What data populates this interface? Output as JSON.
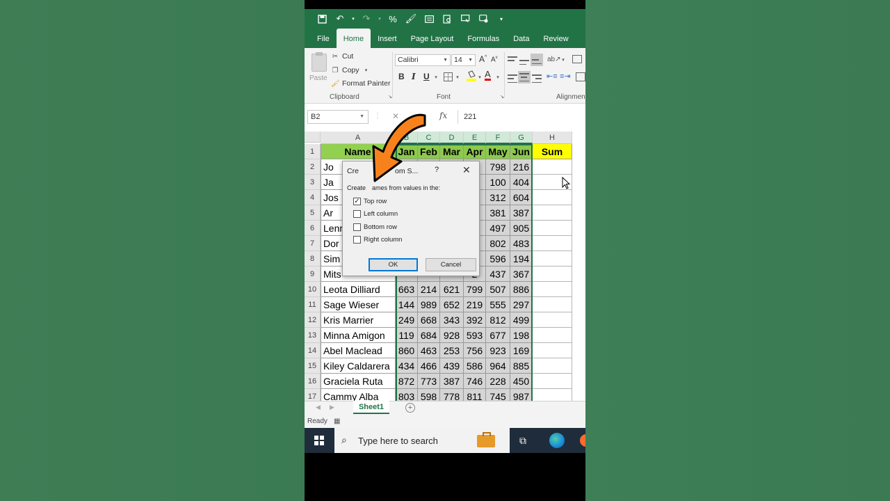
{
  "qat": {
    "icons": [
      "save-icon",
      "undo-icon",
      "redo-icon",
      "percent-icon",
      "format-painter-icon",
      "form-icon",
      "print-preview-icon",
      "slideshow-icon",
      "comment-icon",
      "customize-icon"
    ]
  },
  "ribbon_tabs": [
    "File",
    "Home",
    "Insert",
    "Page Layout",
    "Formulas",
    "Data",
    "Review"
  ],
  "clipboard": {
    "paste": "Paste",
    "cut": "Cut",
    "copy": "Copy",
    "format_painter": "Format Painter",
    "group": "Clipboard"
  },
  "font": {
    "name": "Calibri",
    "size": "14",
    "grow": "A",
    "shrink": "A",
    "bold": "B",
    "italic": "I",
    "underline": "U",
    "group": "Font"
  },
  "alignment": {
    "group": "Alignment"
  },
  "formula_bar": {
    "name_box": "B2",
    "fx": "fx",
    "value": "221"
  },
  "columns": [
    "A",
    "B",
    "C",
    "D",
    "E",
    "F",
    "G",
    "H"
  ],
  "row_numbers": [
    "1",
    "2",
    "3",
    "4",
    "5",
    "6",
    "7",
    "8",
    "9",
    "10",
    "11",
    "12",
    "13",
    "14",
    "15",
    "16",
    "17"
  ],
  "header_row": [
    "Name",
    "Jan",
    "Feb",
    "Mar",
    "Apr",
    "May",
    "Jun",
    "Sum"
  ],
  "rows": [
    [
      "Jo",
      "",
      "",
      "",
      "7",
      "798",
      "216"
    ],
    [
      "Ja",
      "",
      "",
      "",
      "1",
      "100",
      "404"
    ],
    [
      "Jos",
      "",
      "",
      "",
      "1",
      "312",
      "604"
    ],
    [
      "Ar",
      "",
      "",
      "",
      "0",
      "381",
      "387"
    ],
    [
      "Lenr",
      "",
      "",
      "",
      "5",
      "497",
      "905"
    ],
    [
      "Dor",
      "",
      "",
      "",
      "2",
      "802",
      "483"
    ],
    [
      "Sim",
      "",
      "",
      "",
      "2",
      "596",
      "194"
    ],
    [
      "Mits",
      "",
      "",
      "",
      "2",
      "437",
      "367"
    ],
    [
      "Leota Dilliard",
      "663",
      "214",
      "621",
      "799",
      "507",
      "886"
    ],
    [
      "Sage Wieser",
      "144",
      "989",
      "652",
      "219",
      "555",
      "297"
    ],
    [
      "Kris Marrier",
      "249",
      "668",
      "343",
      "392",
      "812",
      "499"
    ],
    [
      "Minna Amigon",
      "119",
      "684",
      "928",
      "593",
      "677",
      "198"
    ],
    [
      "Abel Maclead",
      "860",
      "463",
      "253",
      "756",
      "923",
      "169"
    ],
    [
      "Kiley Caldarera",
      "434",
      "466",
      "439",
      "586",
      "964",
      "885"
    ],
    [
      "Graciela Ruta",
      "872",
      "773",
      "387",
      "746",
      "228",
      "450"
    ],
    [
      "Cammy Alba",
      "803",
      "598",
      "778",
      "811",
      "745",
      "987"
    ]
  ],
  "sheet": {
    "tab": "Sheet1",
    "add": "+",
    "status": "Ready"
  },
  "dialog": {
    "title": "Cre",
    "title_tail": "om S...",
    "help": "?",
    "intro_left": "Create",
    "intro_right": "ames from values in the:",
    "options": [
      {
        "label": "Top row",
        "checked": true
      },
      {
        "label": "Left column",
        "checked": false
      },
      {
        "label": "Bottom row",
        "checked": false
      },
      {
        "label": "Right column",
        "checked": false
      }
    ],
    "ok": "OK",
    "cancel": "Cancel"
  },
  "taskbar": {
    "search_placeholder": "Type here to search"
  },
  "colors": {
    "excel_green": "#217346",
    "header_fill": "#92d050",
    "sum_fill": "#ffff00",
    "arrow": "#f7821b",
    "background": "#3f7d55"
  }
}
